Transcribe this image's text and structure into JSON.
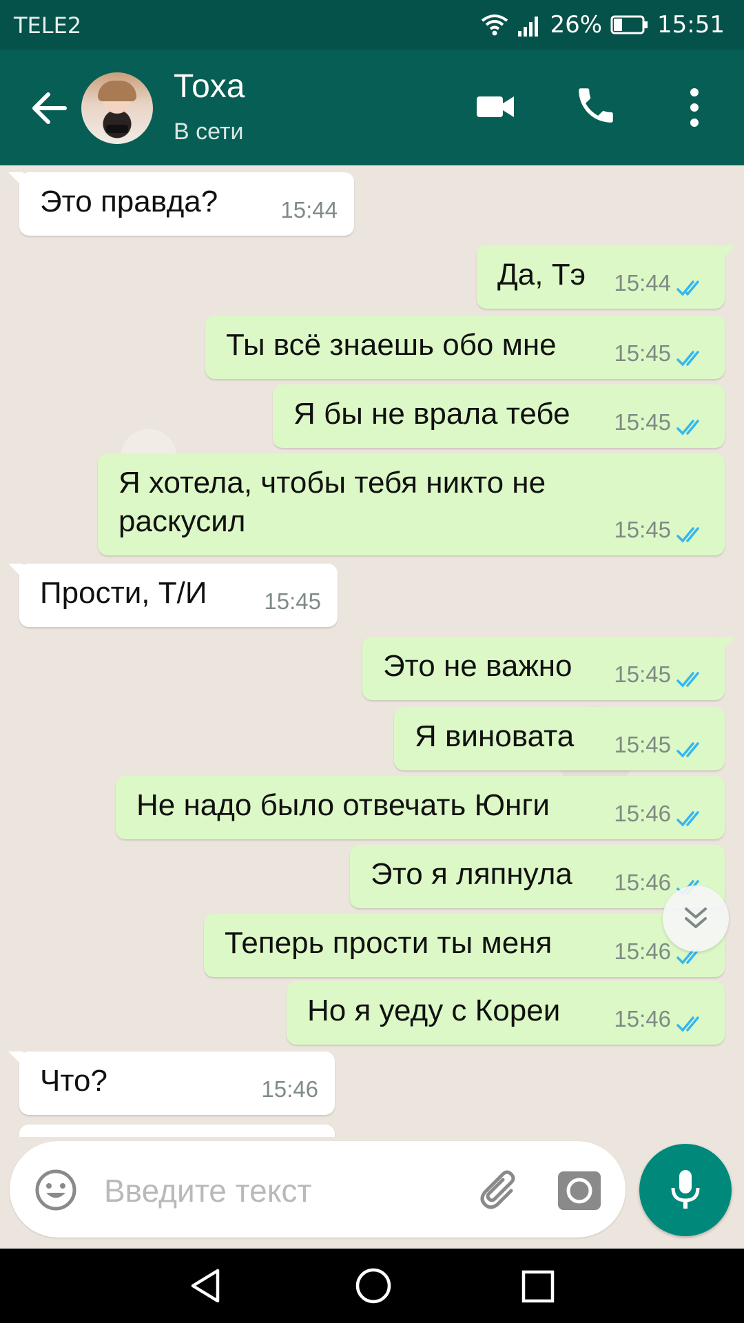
{
  "status_bar": {
    "carrier": "TELE2",
    "battery": "26%",
    "time": "15:51"
  },
  "header": {
    "contact_name": "Тоха",
    "contact_status": "В сети"
  },
  "messages": [
    {
      "direction": "in",
      "text": "Это правда?",
      "time": "15:44"
    },
    {
      "direction": "out",
      "text": "Да, Тэ",
      "time": "15:44",
      "read": true
    },
    {
      "direction": "out",
      "text": "Ты всё знаешь обо мне",
      "time": "15:45",
      "read": true
    },
    {
      "direction": "out",
      "text": "Я бы не врала тебе",
      "time": "15:45",
      "read": true
    },
    {
      "direction": "out",
      "text": "Я хотела, чтобы тебя никто не",
      "text2": "раскусил",
      "time": "15:45",
      "read": true
    },
    {
      "direction": "in",
      "text": "Прости, Т/И",
      "time": "15:45"
    },
    {
      "direction": "out",
      "text": "Это не важно",
      "time": "15:45",
      "read": true
    },
    {
      "direction": "out",
      "text": "Я виновата",
      "time": "15:45",
      "read": true
    },
    {
      "direction": "out",
      "text": "Не надо было отвечать Юнги",
      "time": "15:46",
      "read": true
    },
    {
      "direction": "out",
      "text": "Это я ляпнула",
      "time": "15:46",
      "read": true
    },
    {
      "direction": "out",
      "text": "Теперь прости ты меня",
      "time": "15:46",
      "read": true
    },
    {
      "direction": "out",
      "text": "Но я уеду с Кореи",
      "time": "15:46",
      "read": true
    },
    {
      "direction": "in",
      "text": "Что?",
      "time": "15:46"
    }
  ],
  "composer": {
    "placeholder": "Введите текст"
  },
  "colors": {
    "toolbar": "#075e54",
    "status_bar": "#05524a",
    "outgoing_bubble": "#dcf8c6",
    "incoming_bubble": "#ffffff",
    "read_ticks": "#34b7f1",
    "mic_button": "#00897b"
  },
  "icons": {
    "back": "arrow-left-icon",
    "video": "video-camera-icon",
    "call": "phone-icon",
    "menu": "more-vertical-icon",
    "emoji": "smiley-icon",
    "attach": "paperclip-icon",
    "camera": "camera-icon",
    "mic": "microphone-icon",
    "scroll": "double-chevron-down-icon"
  }
}
